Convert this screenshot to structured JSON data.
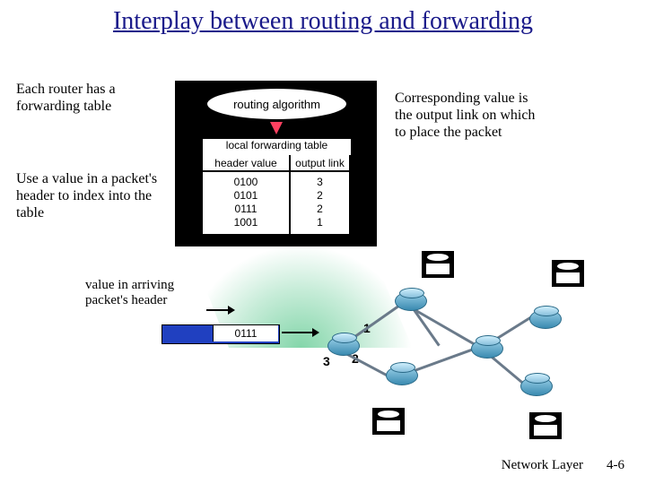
{
  "title": "Interplay between routing and forwarding",
  "notes": {
    "each_router": "Each router has a forwarding table",
    "use_value": "Use a value in a packet's header to index into the table",
    "corresponding": "Corresponding value is the output link on which to place the packet",
    "arriving_value": "value in arriving packet's header"
  },
  "router_box": {
    "algorithm_label": "routing algorithm",
    "table_caption": "local forwarding table",
    "columns": [
      "header value",
      "output link"
    ],
    "rows": [
      {
        "header": "0100",
        "output": "3"
      },
      {
        "header": "0101",
        "output": "2"
      },
      {
        "header": "0111",
        "output": "2"
      },
      {
        "header": "1001",
        "output": "1"
      }
    ]
  },
  "packet": {
    "header_value": "0111"
  },
  "ports": {
    "p1": "1",
    "p2": "2",
    "p3": "3"
  },
  "footer": {
    "chapter": "Network Layer",
    "page": "4-6"
  }
}
